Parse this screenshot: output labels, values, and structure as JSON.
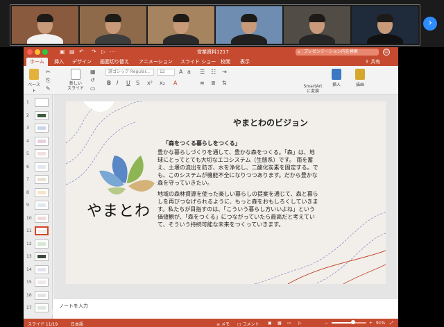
{
  "participants": [
    {
      "bg": "#8a5a3e",
      "shirt": "#f2f2f2"
    },
    {
      "bg": "#8e6a4b",
      "shirt": "#3d3d3d"
    },
    {
      "bg": "#a5845f",
      "shirt": "#2a2a2a"
    },
    {
      "bg": "#6e8db1",
      "shirt": "#202020"
    },
    {
      "bg": "#514c45",
      "shirt": "#262626"
    },
    {
      "bg": "#1f2a3a",
      "shirt": "#111111"
    }
  ],
  "strip": {
    "next": "›"
  },
  "window": {
    "doc_title": "営業資料1217",
    "search_placeholder": "プレゼンテーション内を検索",
    "share": "共有",
    "tabs": [
      "ホーム",
      "挿入",
      "デザイン",
      "画面切り替え",
      "アニメーション",
      "スライド ショー",
      "校閲",
      "表示"
    ]
  },
  "ribbon": {
    "paste": "ペースト",
    "new_slide": "新しい\nスライド",
    "font": "游ゴシック Regular...",
    "size": "12",
    "smartart": "SmartArt\nに変換",
    "insert": "挿入",
    "draw": "描画"
  },
  "thumbnails": [
    "1",
    "2",
    "3",
    "4",
    "5",
    "6",
    "7",
    "8",
    "9",
    "10",
    "11",
    "12",
    "13",
    "14",
    "15",
    "16",
    "17"
  ],
  "selected_thumb": 10,
  "slide": {
    "title": "やまとわのビジョン",
    "subtitle": "「森をつくる暮らしをつくる」",
    "para1_lines": [
      "豊かな暮らしづくりを通して、豊かな森をつくる。「森」は、地",
      "球にとってとても大切なエコシステム（生態系）です。 雨を蓄",
      "え、土壌の流出を防ぎ、水を浄化し、二酸化炭素を固定する。で",
      "も、このシステムが機能不全になりつつあります。だから豊かな",
      "森を守っていきたい。"
    ],
    "para2_lines": [
      "地域の森林資源を使った楽しい暮らしの提案を通じて、森と暮ら",
      "しを再びつなげられるように、もっと森をおもしろくしていきま",
      "す。私たちが目指すのは、「こういう暮らし方いいよね」という",
      "価値観が、「森をつくる」につながっていたら最高だと考えてい",
      "て、そういう持続可能な未来をつくっていきます。"
    ],
    "logo": "やまとわ"
  },
  "notes_placeholder": "ノートを入力",
  "status": {
    "slide_pos": "スライド 11/19",
    "lang": "日本語",
    "memo": "メモ",
    "comment": "コメント",
    "zoom": "91%",
    "zoom_level": 0.62
  }
}
